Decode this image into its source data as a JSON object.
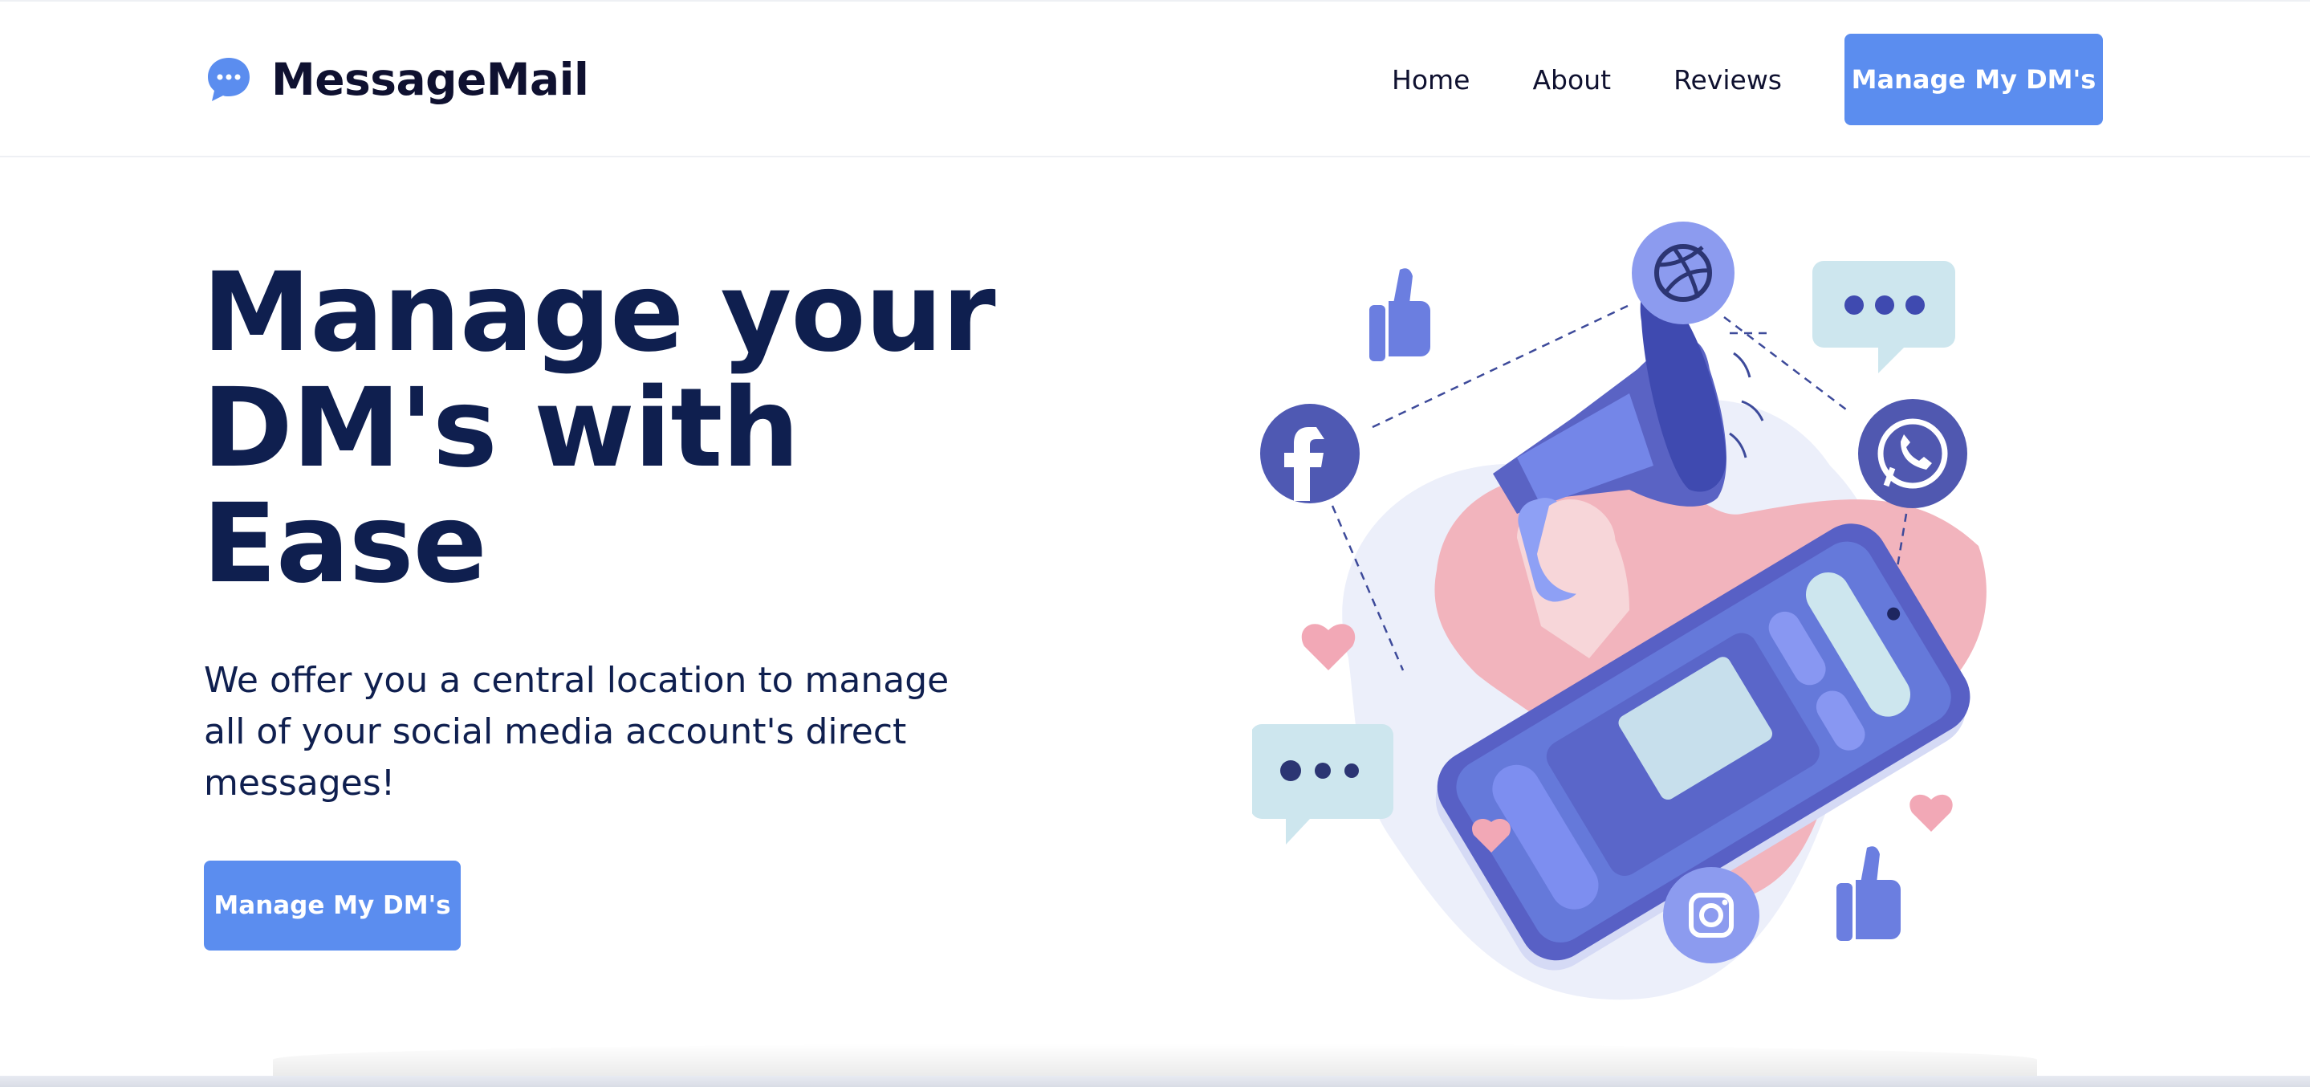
{
  "brand": {
    "name": "MessageMail",
    "icon": "chat-bubble-icon",
    "accent": "#5b8def"
  },
  "nav": {
    "links": [
      "Home",
      "About",
      "Reviews"
    ],
    "cta": "Manage My DM's"
  },
  "hero": {
    "title": "Manage your DM's with Ease",
    "subtitle": "We offer you a central location to manage all of your social media account's direct messages!",
    "cta": "Manage My DM's"
  },
  "illustration": {
    "icons": [
      "facebook-icon",
      "dribbble-icon",
      "whatsapp-icon",
      "instagram-icon",
      "megaphone-icon",
      "phone-icon",
      "thumbs-up-icon",
      "heart-icon",
      "chat-bubble-icon"
    ],
    "colors": {
      "indigo": "#5a63c4",
      "periwinkle": "#6b7ee0",
      "pink": "#f2b4bd",
      "lavender": "#eceffa",
      "light-blue": "#cde6ee"
    }
  }
}
